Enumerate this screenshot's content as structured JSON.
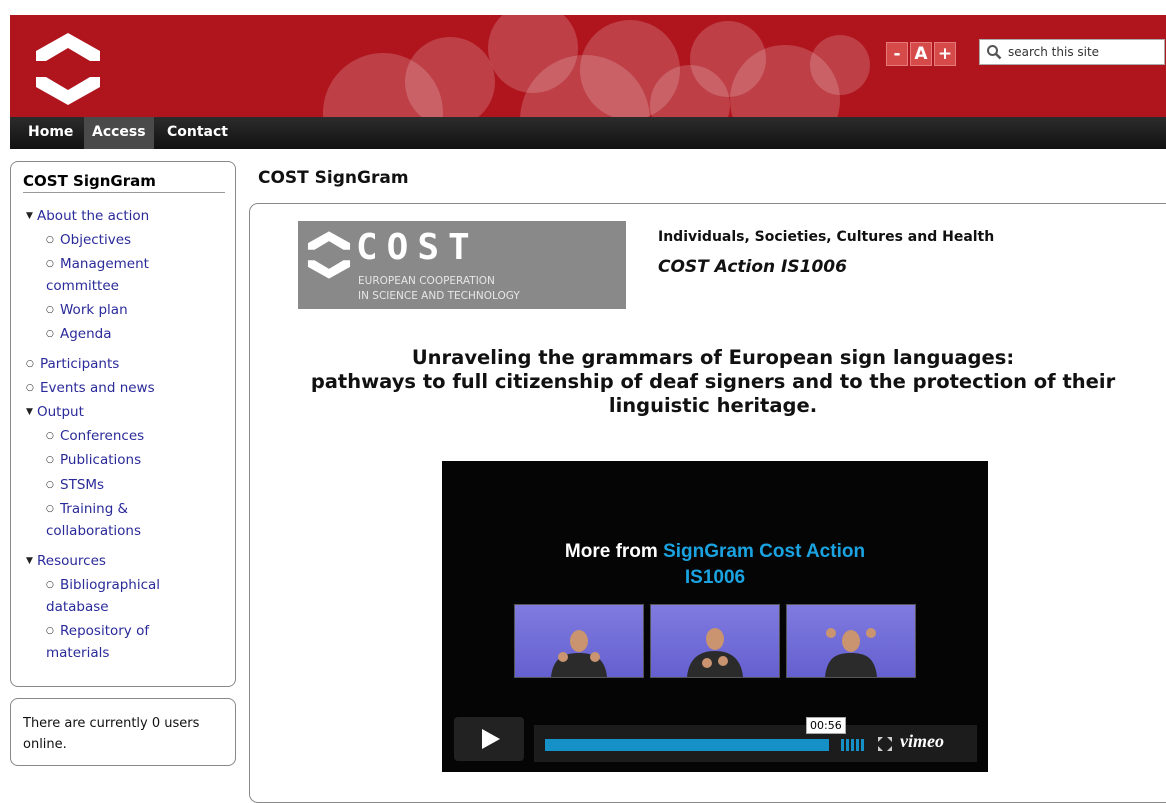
{
  "header": {
    "logo_icon": "cost-logo-icon",
    "text_size": {
      "decrease": "-",
      "reset": "A",
      "increase": "+"
    },
    "search_placeholder": "search this site",
    "colors": {
      "banner": "#b0151e",
      "nav": "#1a1a1a"
    }
  },
  "nav": {
    "items": [
      {
        "label": "Home",
        "active": false
      },
      {
        "label": "Access",
        "active": true
      },
      {
        "label": "Contact",
        "active": false
      }
    ]
  },
  "sidebar": {
    "title": "COST SignGram",
    "menu": [
      {
        "label": "About the action",
        "expanded": true
      },
      {
        "label": "Objectives"
      },
      {
        "label": "Management committee"
      },
      {
        "label": "Work plan"
      },
      {
        "label": "Agenda"
      },
      {
        "label": "Participants"
      },
      {
        "label": "Events and news"
      },
      {
        "label": "Output",
        "expanded": true
      },
      {
        "label": "Conferences"
      },
      {
        "label": "Publications"
      },
      {
        "label": "STSMs"
      },
      {
        "label": "Training & collaborations"
      },
      {
        "label": "Resources",
        "expanded": true
      },
      {
        "label": "Bibliographical database"
      },
      {
        "label": "Repository of materials"
      }
    ],
    "online_users": "There are currently 0 users online."
  },
  "main": {
    "title": "COST SignGram",
    "cost_logo": {
      "word": "COST",
      "subtitle": [
        "EUROPEAN COOPERATION",
        "IN SCIENCE AND TECHNOLOGY"
      ]
    },
    "domain": "Individuals, Societies, Cultures and Health",
    "action": "COST Action IS1006",
    "headline": [
      "Unraveling the grammars of European sign languages:",
      "pathways to full citizenship of deaf signers and to the protection of their",
      "linguistic heritage."
    ]
  },
  "video": {
    "more_from": "More from",
    "channel": [
      "SignGram Cost Action",
      "IS1006"
    ],
    "timestamp": "00:56",
    "brand": "vimeo",
    "progress": 0.96,
    "accent": "#1aa3e0"
  }
}
